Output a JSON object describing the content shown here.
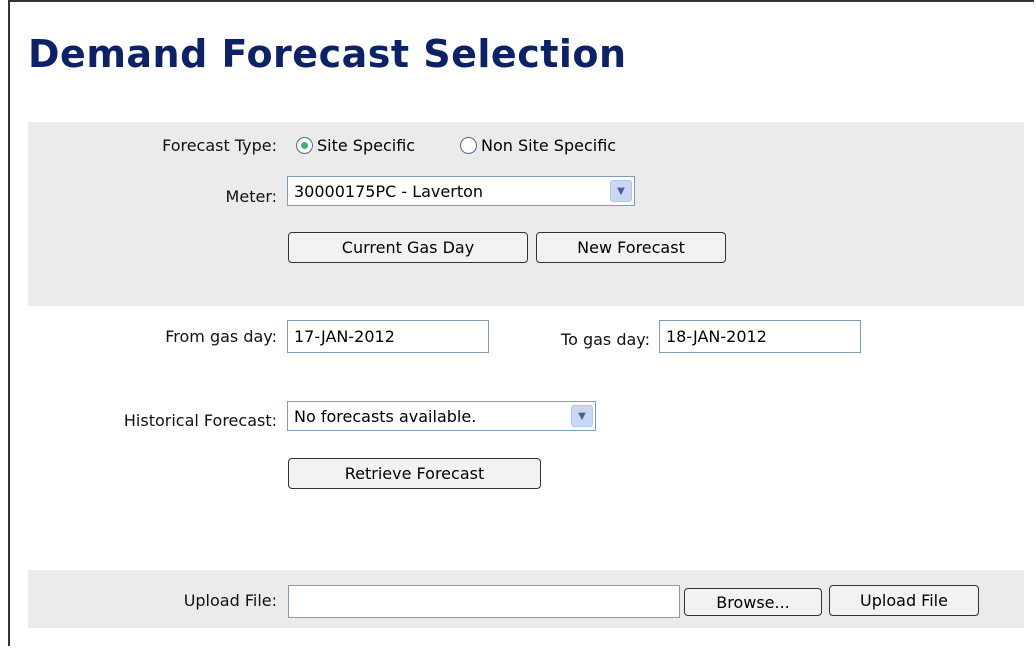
{
  "page": {
    "title": "Demand Forecast Selection"
  },
  "forecast_type": {
    "label": "Forecast Type:",
    "options": [
      {
        "label": "Site Specific",
        "selected": true
      },
      {
        "label": "Non Site Specific",
        "selected": false
      }
    ]
  },
  "meter": {
    "label": "Meter:",
    "value": "30000175PC - Laverton"
  },
  "buttons": {
    "current_gas_day": "Current Gas Day",
    "new_forecast": "New Forecast",
    "retrieve_forecast": "Retrieve Forecast",
    "browse": "Browse...",
    "upload_file": "Upload File"
  },
  "from_gas_day": {
    "label": "From gas day:",
    "value": "17-JAN-2012"
  },
  "to_gas_day": {
    "label": "To gas day:",
    "value": "18-JAN-2012"
  },
  "historical_forecast": {
    "label": "Historical Forecast:",
    "value": "No forecasts available."
  },
  "upload": {
    "label": "Upload File:",
    "value": ""
  },
  "colors": {
    "title": "#0d2266",
    "band": "#ebebeb",
    "radio_selected": "#3cb371"
  }
}
